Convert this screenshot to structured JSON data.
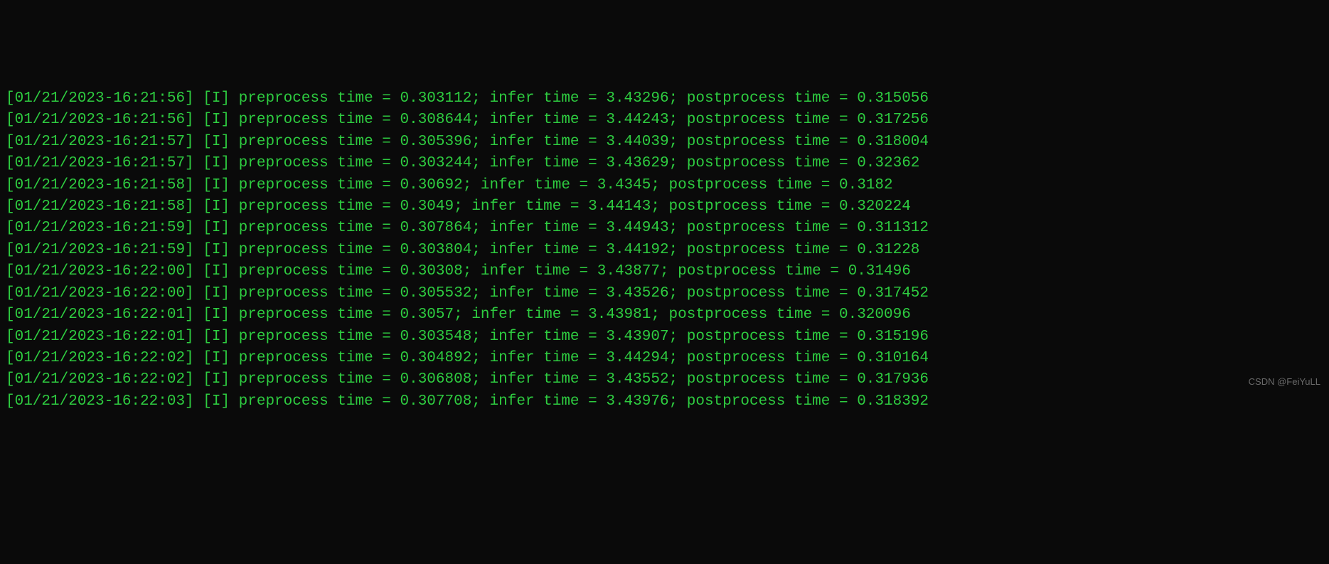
{
  "watermark": "CSDN @FeiYuLL",
  "log_entries": [
    {
      "timestamp": "01/21/2023-16:21:56",
      "level": "I",
      "preprocess": "0.303112",
      "infer": "3.43296",
      "postprocess": "0.315056"
    },
    {
      "timestamp": "01/21/2023-16:21:56",
      "level": "I",
      "preprocess": "0.308644",
      "infer": "3.44243",
      "postprocess": "0.317256"
    },
    {
      "timestamp": "01/21/2023-16:21:57",
      "level": "I",
      "preprocess": "0.305396",
      "infer": "3.44039",
      "postprocess": "0.318004"
    },
    {
      "timestamp": "01/21/2023-16:21:57",
      "level": "I",
      "preprocess": "0.303244",
      "infer": "3.43629",
      "postprocess": "0.32362"
    },
    {
      "timestamp": "01/21/2023-16:21:58",
      "level": "I",
      "preprocess": "0.30692",
      "infer": "3.4345",
      "postprocess": "0.3182"
    },
    {
      "timestamp": "01/21/2023-16:21:58",
      "level": "I",
      "preprocess": "0.3049",
      "infer": "3.44143",
      "postprocess": "0.320224"
    },
    {
      "timestamp": "01/21/2023-16:21:59",
      "level": "I",
      "preprocess": "0.307864",
      "infer": "3.44943",
      "postprocess": "0.311312"
    },
    {
      "timestamp": "01/21/2023-16:21:59",
      "level": "I",
      "preprocess": "0.303804",
      "infer": "3.44192",
      "postprocess": "0.31228"
    },
    {
      "timestamp": "01/21/2023-16:22:00",
      "level": "I",
      "preprocess": "0.30308",
      "infer": "3.43877",
      "postprocess": "0.31496"
    },
    {
      "timestamp": "01/21/2023-16:22:00",
      "level": "I",
      "preprocess": "0.305532",
      "infer": "3.43526",
      "postprocess": "0.317452"
    },
    {
      "timestamp": "01/21/2023-16:22:01",
      "level": "I",
      "preprocess": "0.3057",
      "infer": "3.43981",
      "postprocess": "0.320096"
    },
    {
      "timestamp": "01/21/2023-16:22:01",
      "level": "I",
      "preprocess": "0.303548",
      "infer": "3.43907",
      "postprocess": "0.315196"
    },
    {
      "timestamp": "01/21/2023-16:22:02",
      "level": "I",
      "preprocess": "0.304892",
      "infer": "3.44294",
      "postprocess": "0.310164"
    },
    {
      "timestamp": "01/21/2023-16:22:02",
      "level": "I",
      "preprocess": "0.306808",
      "infer": "3.43552",
      "postprocess": "0.317936"
    },
    {
      "timestamp": "01/21/2023-16:22:03",
      "level": "I",
      "preprocess": "0.307708",
      "infer": "3.43976",
      "postprocess": "0.318392"
    }
  ]
}
